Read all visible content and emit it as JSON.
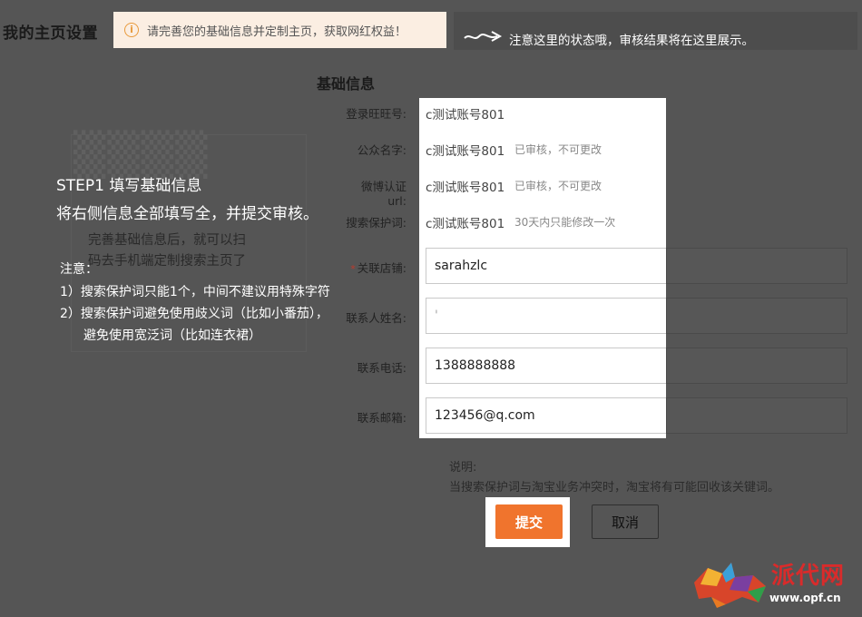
{
  "header": {
    "page_title": "我的主页设置",
    "notice_icon": "i",
    "notice_text": "请完善您的基础信息并定制主页，获取网红权益！",
    "status_hint": "注意这里的状态哦，审核结果将在这里展示。"
  },
  "form": {
    "section_title": "基础信息",
    "rows": [
      {
        "label": "登录旺旺号:",
        "value": "c测试账号801",
        "note": ""
      },
      {
        "label": "公众名字:",
        "value": "c测试账号801",
        "note": "已审核，不可更改"
      },
      {
        "label": "微博认证url:",
        "value": "c测试账号801",
        "note": "已审核，不可更改"
      },
      {
        "label": "搜索保护词:",
        "value": "c测试账号801",
        "note": "30天内只能修改一次"
      }
    ],
    "fields": [
      {
        "label": "关联店铺:",
        "required_mark": "*",
        "value": "sarahzlc"
      },
      {
        "label": "联系人姓名:",
        "value": "'"
      },
      {
        "label": "联系电话:",
        "value": "1388888888"
      },
      {
        "label": "联系邮箱:",
        "value": "123456@q.com"
      }
    ],
    "explain_title": "说明:",
    "explain_text": "当搜索保护词与淘宝业务冲突时，淘宝将有可能回收该关键词。",
    "submit_label": "提交",
    "cancel_label": "取消"
  },
  "guide": {
    "step_title": "STEP1   填写基础信息",
    "step_desc": "将右侧信息全部填写全，并提交审核。",
    "ghost_line1": "完善基础信息后，就可以扫",
    "ghost_line2": "码去手机端定制搜索主页了",
    "note_title": "注意：",
    "note_1": "1）搜索保护词只能1个，中间不建议用特殊字符",
    "note_2": "2）搜索保护词避免使用歧义词（比如小番茄），",
    "note_3": "避免使用宽泛词（比如连衣裙）"
  },
  "watermark": {
    "brand": "派代网",
    "url": "www.opf.cn"
  }
}
